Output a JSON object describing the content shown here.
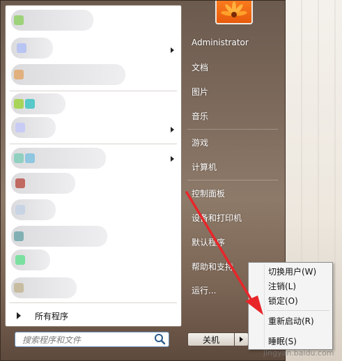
{
  "start_menu": {
    "all_programs_label": "所有程序",
    "search_placeholder": "搜索程序和文件",
    "user_name": "Administrator",
    "right_items": [
      {
        "label": "Administrator"
      },
      {
        "label": "文档"
      },
      {
        "label": "图片"
      },
      {
        "label": "音乐"
      },
      {
        "label": "游戏"
      },
      {
        "label": "计算机"
      },
      {
        "label": "控制面板"
      },
      {
        "label": "设备和打印机"
      },
      {
        "label": "默认程序"
      },
      {
        "label": "帮助和支持"
      },
      {
        "label": "运行..."
      }
    ],
    "shutdown_label": "关机"
  },
  "power_submenu": {
    "items": [
      {
        "label": "切换用户(W)"
      },
      {
        "label": "注销(L)"
      },
      {
        "label": "锁定(O)"
      },
      {
        "label": "重新启动(R)"
      },
      {
        "label": "睡眠(S)"
      }
    ]
  },
  "watermark": "jingyan.baidu.com",
  "colors": {
    "annotation_arrow": "#e8262a",
    "user_tile": "#f26a14"
  },
  "icons": {
    "user": "flower-avatar-icon",
    "search": "search-icon",
    "all_programs": "triangle-right-icon",
    "shutdown_options": "triangle-right-icon"
  }
}
